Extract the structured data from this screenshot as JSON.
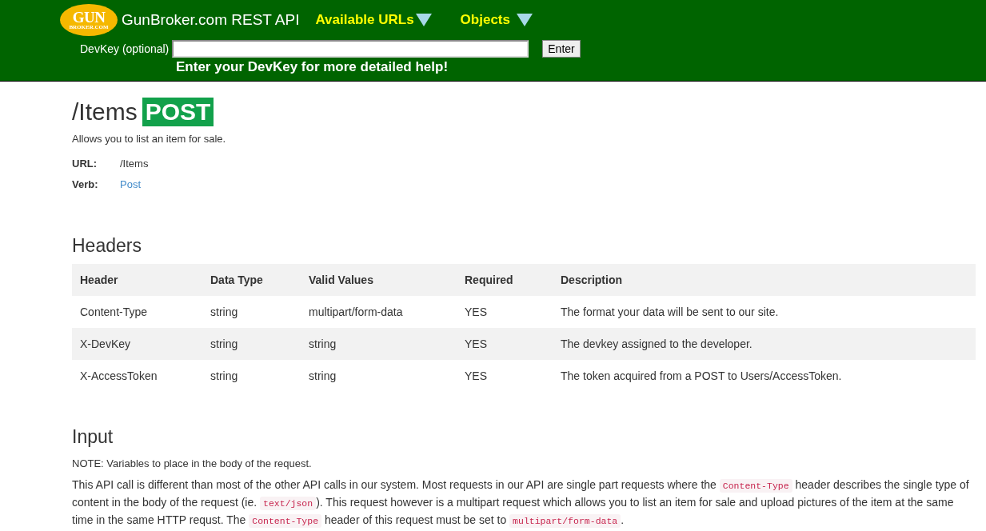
{
  "header": {
    "logo": {
      "top": "GUN",
      "bottom": "BROKER.COM"
    },
    "title": "GunBroker.com REST API",
    "menus": [
      {
        "label": "Available URLs"
      },
      {
        "label": "Objects"
      }
    ],
    "devkey": {
      "label": "DevKey (optional)",
      "button": "Enter"
    },
    "hint": "Enter your DevKey for more detailed help!"
  },
  "endpoint": {
    "path": "/Items",
    "verb_badge": "POST",
    "description": "Allows you to list an item for sale.",
    "fields": [
      {
        "label": "URL:",
        "value": "/Items",
        "kind": "text"
      },
      {
        "label": "Verb:",
        "value": "Post",
        "kind": "link"
      }
    ]
  },
  "headers_section": {
    "title": "Headers",
    "columns": [
      "Header",
      "Data Type",
      "Valid Values",
      "Required",
      "Description"
    ],
    "rows": [
      [
        "Content-Type",
        "string",
        "multipart/form-data",
        "YES",
        "The format your data will be sent to our site."
      ],
      [
        "X-DevKey",
        "string",
        "string",
        "YES",
        "The devkey assigned to the developer."
      ],
      [
        "X-AccessToken",
        "string",
        "string",
        "YES",
        "The token acquired from a POST to Users/AccessToken."
      ]
    ]
  },
  "input_section": {
    "title": "Input",
    "note": "NOTE: Variables to place in the body of the request.",
    "paragraph": [
      {
        "kind": "text",
        "text": "This API call is different than most of the other API calls in our system. Most requests in our API are single part requests where the "
      },
      {
        "kind": "code",
        "text": "Content-Type"
      },
      {
        "kind": "text",
        "text": " header describes the single type of content in the body of the request (ie. "
      },
      {
        "kind": "code",
        "text": "text/json"
      },
      {
        "kind": "text",
        "text": "). This request however is a multipart request which allows you to list an item for sale and upload pictures of the item at the same time in the same HTTP requst. The "
      },
      {
        "kind": "code",
        "text": "Content-Type"
      },
      {
        "kind": "text",
        "text": " header of this request must be set to "
      },
      {
        "kind": "code",
        "text": "multipart/form-data"
      },
      {
        "kind": "text",
        "text": "."
      }
    ]
  }
}
